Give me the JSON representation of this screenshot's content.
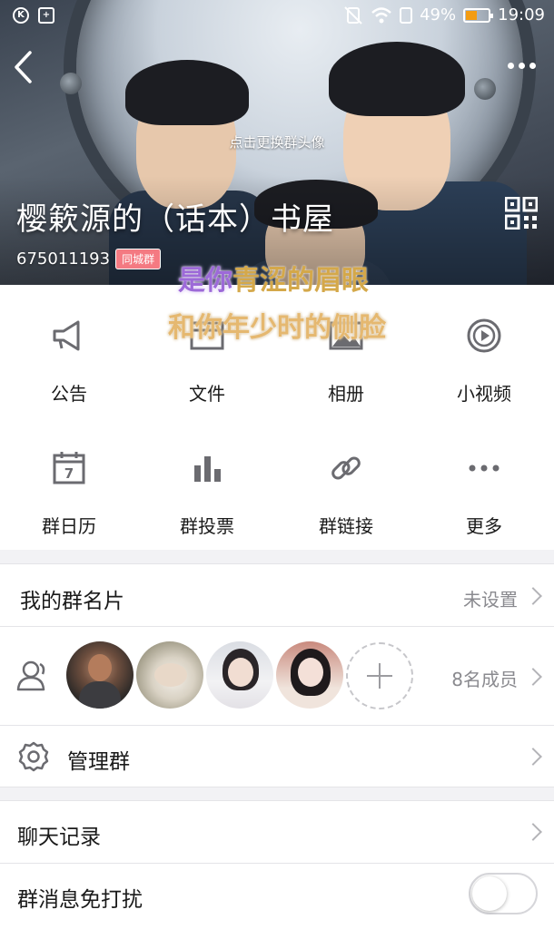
{
  "status_bar": {
    "battery_percent": "49%",
    "battery_level": 0.49,
    "time": "19:09"
  },
  "header": {
    "change_avatar_hint": "点击更换群头像",
    "group_name": "樱簌源的（话本）书屋",
    "group_id": "675011193",
    "group_badge": "同城群"
  },
  "lyrics": {
    "line1_part1": "是你",
    "line1_part2": "青",
    "line1_part3": "涩的眉眼",
    "line2": "和你年少时的侧脸"
  },
  "features": [
    {
      "label": "公告",
      "icon": "megaphone-icon"
    },
    {
      "label": "文件",
      "icon": "folder-icon"
    },
    {
      "label": "相册",
      "icon": "album-icon"
    },
    {
      "label": "小视频",
      "icon": "video-play-icon"
    },
    {
      "label": "群日历",
      "icon": "calendar-icon"
    },
    {
      "label": "群投票",
      "icon": "bar-chart-icon"
    },
    {
      "label": "群链接",
      "icon": "link-icon"
    },
    {
      "label": "更多",
      "icon": "more-dots-icon"
    }
  ],
  "calendar_day": "7",
  "my_card": {
    "title": "我的群名片",
    "value": "未设置"
  },
  "members": {
    "count_label": "8名成员"
  },
  "manage": {
    "title": "管理群"
  },
  "chat_history": {
    "title": "聊天记录"
  },
  "mute": {
    "title": "群消息免打扰",
    "enabled": false
  },
  "colors": {
    "accent_badge": "#f47a82",
    "battery": "#f39c12",
    "icon_gray": "#6b6b70"
  }
}
